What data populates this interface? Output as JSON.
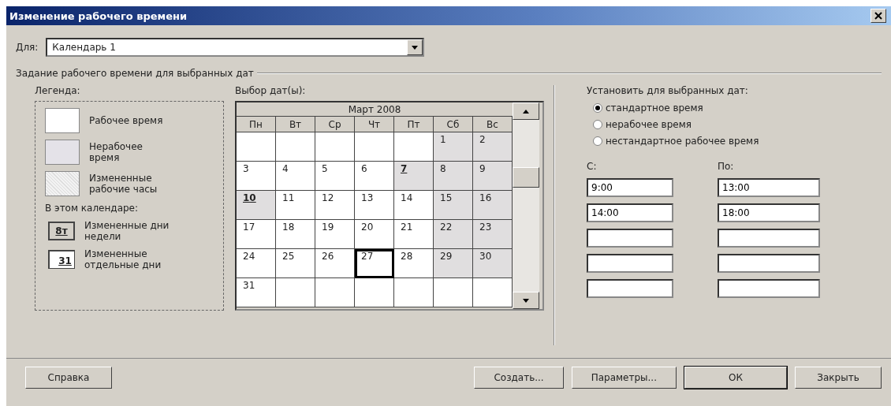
{
  "window": {
    "title": "Изменение рабочего времени"
  },
  "for_field": {
    "label": "Для:",
    "value": "Календарь 1"
  },
  "group_title": "Задание рабочего времени для выбранных дат",
  "legend": {
    "title": "Легенда:",
    "items": [
      {
        "kind": "working",
        "label": "Рабочее время"
      },
      {
        "kind": "nonworking",
        "label": "Нерабочее время"
      },
      {
        "kind": "changed",
        "label": "Измененные рабочие часы"
      }
    ],
    "subtitle": "В этом календаре:",
    "samples": [
      {
        "kind": "weekday",
        "sample": "8т",
        "label": "Измененные дни недели"
      },
      {
        "kind": "day",
        "sample": "31",
        "label": "Измененные отдельные дни"
      }
    ]
  },
  "calendar": {
    "label": "Выбор дат(ы):",
    "month": "Март 2008",
    "weekdays": [
      "Пн",
      "Вт",
      "Ср",
      "Чт",
      "Пт",
      "Сб",
      "Вс"
    ],
    "weeks": [
      [
        {
          "nonworking": false
        },
        {
          "nonworking": false
        },
        {
          "nonworking": false
        },
        {
          "nonworking": false
        },
        {
          "nonworking": false
        },
        {
          "day": "1",
          "nonworking": true,
          "exception": false,
          "selected": false
        },
        {
          "day": "2",
          "nonworking": true,
          "exception": false,
          "selected": false
        }
      ],
      [
        {
          "day": "3",
          "nonworking": false,
          "exception": false,
          "selected": false
        },
        {
          "day": "4",
          "nonworking": false,
          "exception": false,
          "selected": false
        },
        {
          "day": "5",
          "nonworking": false,
          "exception": false,
          "selected": false
        },
        {
          "day": "6",
          "nonworking": false,
          "exception": false,
          "selected": false
        },
        {
          "day": "7",
          "nonworking": true,
          "exception": true,
          "selected": false
        },
        {
          "day": "8",
          "nonworking": true,
          "exception": false,
          "selected": false
        },
        {
          "day": "9",
          "nonworking": true,
          "exception": false,
          "selected": false
        }
      ],
      [
        {
          "day": "10",
          "nonworking": true,
          "exception": true,
          "selected": false
        },
        {
          "day": "11",
          "nonworking": false,
          "exception": false,
          "selected": false
        },
        {
          "day": "12",
          "nonworking": false,
          "exception": false,
          "selected": false
        },
        {
          "day": "13",
          "nonworking": false,
          "exception": false,
          "selected": false
        },
        {
          "day": "14",
          "nonworking": false,
          "exception": false,
          "selected": false
        },
        {
          "day": "15",
          "nonworking": true,
          "exception": false,
          "selected": false
        },
        {
          "day": "16",
          "nonworking": true,
          "exception": false,
          "selected": false
        }
      ],
      [
        {
          "day": "17",
          "nonworking": false,
          "exception": false,
          "selected": false
        },
        {
          "day": "18",
          "nonworking": false,
          "exception": false,
          "selected": false
        },
        {
          "day": "19",
          "nonworking": false,
          "exception": false,
          "selected": false
        },
        {
          "day": "20",
          "nonworking": false,
          "exception": false,
          "selected": false
        },
        {
          "day": "21",
          "nonworking": false,
          "exception": false,
          "selected": false
        },
        {
          "day": "22",
          "nonworking": true,
          "exception": false,
          "selected": false
        },
        {
          "day": "23",
          "nonworking": true,
          "exception": false,
          "selected": false
        }
      ],
      [
        {
          "day": "24",
          "nonworking": false,
          "exception": false,
          "selected": false
        },
        {
          "day": "25",
          "nonworking": false,
          "exception": false,
          "selected": false
        },
        {
          "day": "26",
          "nonworking": false,
          "exception": false,
          "selected": false
        },
        {
          "day": "27",
          "nonworking": false,
          "exception": false,
          "selected": true
        },
        {
          "day": "28",
          "nonworking": false,
          "exception": false,
          "selected": false
        },
        {
          "day": "29",
          "nonworking": true,
          "exception": false,
          "selected": false
        },
        {
          "day": "30",
          "nonworking": true,
          "exception": false,
          "selected": false
        }
      ],
      [
        {
          "day": "31",
          "nonworking": false,
          "exception": false,
          "selected": false
        },
        {
          "nonworking": false
        },
        {
          "nonworking": false
        },
        {
          "nonworking": false
        },
        {
          "nonworking": false
        },
        {
          "nonworking": false
        },
        {
          "nonworking": false
        }
      ]
    ]
  },
  "set_for_dates": {
    "title": "Установить для выбранных дат:",
    "options": [
      {
        "label": "стандартное время",
        "selected": true
      },
      {
        "label": "нерабочее время",
        "selected": false
      },
      {
        "label": "нестандартное рабочее время",
        "selected": false
      }
    ],
    "from_label": "С:",
    "to_label": "По:",
    "rows": [
      {
        "from": "9:00",
        "to": "13:00"
      },
      {
        "from": "14:00",
        "to": "18:00"
      },
      {},
      {},
      {}
    ]
  },
  "buttons": [
    {
      "label": "Справка",
      "kind": "left"
    },
    {
      "label": "Создать...",
      "kind": "right"
    },
    {
      "label": "Параметры...",
      "kind": "right"
    },
    {
      "label": "ОК",
      "kind": "default"
    },
    {
      "label": "Закрыть",
      "kind": "right"
    }
  ]
}
